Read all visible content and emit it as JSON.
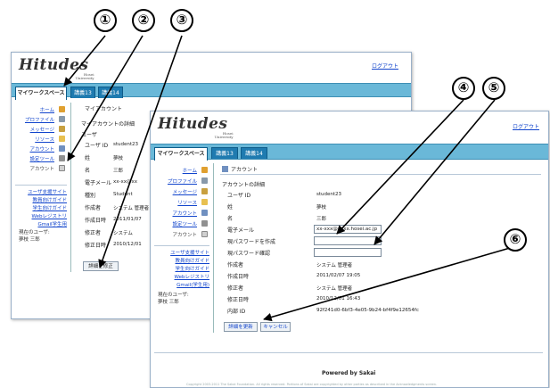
{
  "callouts": [
    "①",
    "②",
    "③",
    "④",
    "⑤",
    "⑥"
  ],
  "logo": {
    "title": "Hitudes",
    "sub": "Hosei\nUniversity"
  },
  "logout": "ログアウト",
  "tabs": [
    "マイワークスペース",
    "講義13",
    "講義14"
  ],
  "back": {
    "sidebar": [
      "ホーム",
      "プロファイル",
      "メッセージ",
      "リソース",
      "アカウント",
      "設定ツール",
      "アカウント"
    ],
    "links": [
      "ユーザ支援サイト",
      "教員向けガイド",
      "学生向けガイド",
      "Webレジストリ",
      "Gmail学生用"
    ],
    "user": [
      "現在のユーザ:",
      "夢枝 三郎"
    ],
    "page_title": "マイアカウント",
    "heading": "マイアカウントの詳細",
    "section": "ユーザ",
    "rows": [
      {
        "label": "ユーザ ID",
        "value": "student23"
      },
      {
        "label": "姓",
        "value": "夢枝"
      },
      {
        "label": "名",
        "value": "三郎"
      },
      {
        "label": "電子メール",
        "value": "xx-xx@xx"
      },
      {
        "label": "種別",
        "value": "Student"
      },
      {
        "label": "作成者",
        "value": "システム 管理者"
      },
      {
        "label": "作成日時",
        "value": "2011/01/07"
      },
      {
        "label": "修正者",
        "value": "システム"
      },
      {
        "label": "修正日時",
        "value": "2010/12/01"
      }
    ],
    "button": "詳細を修正"
  },
  "front": {
    "sidebar": [
      "ホーム",
      "プロファイル",
      "メッセージ",
      "リソース",
      "アカウント",
      "設定ツール",
      "アカウント"
    ],
    "links": [
      "ユーザ支援サイト",
      "教員向けガイド",
      "学生向けガイド",
      "Webレジストリ",
      "Gmail(学生用)"
    ],
    "user": [
      "現在のユーザ:",
      "夢枝 三郎"
    ],
    "page_title": "アカウント",
    "heading": "アカウントの詳細",
    "rows": [
      {
        "label": "ユーザ ID",
        "value": "student23"
      },
      {
        "label": "姓",
        "value": "夢枝"
      },
      {
        "label": "名",
        "value": "三郎"
      },
      {
        "label": "電子メール",
        "value": "xx-xxx@xxxx.hosei.ac.jp"
      },
      {
        "label": "現パスワードを作成",
        "value": ""
      },
      {
        "label": "現パスワード確認",
        "value": ""
      },
      {
        "label": "作成者",
        "value": "システム 管理者"
      },
      {
        "label": "作成日時",
        "value": "2011/02/07 19:05"
      },
      {
        "label": "修正者",
        "value": "システム 管理者"
      },
      {
        "label": "修正日時",
        "value": "2010/12/01 16:43"
      },
      {
        "label": "内部 ID",
        "value": "92f241d0-6bf3-4e05-9b24-bf4f9e12654fc"
      }
    ],
    "buttons": [
      "詳細を更新",
      "キャンセル"
    ],
    "footer": "Powered by Sakai",
    "copyright": "Copyright 2003-2011 The Sakai Foundation. All rights reserved. Portions of Sakai are copyrighted by other parties as described in the Acknowledgments screen."
  },
  "colors": {
    "tabbar": "#6ab8d8",
    "tab": "#1f7bb0",
    "link": "#1144cc"
  }
}
